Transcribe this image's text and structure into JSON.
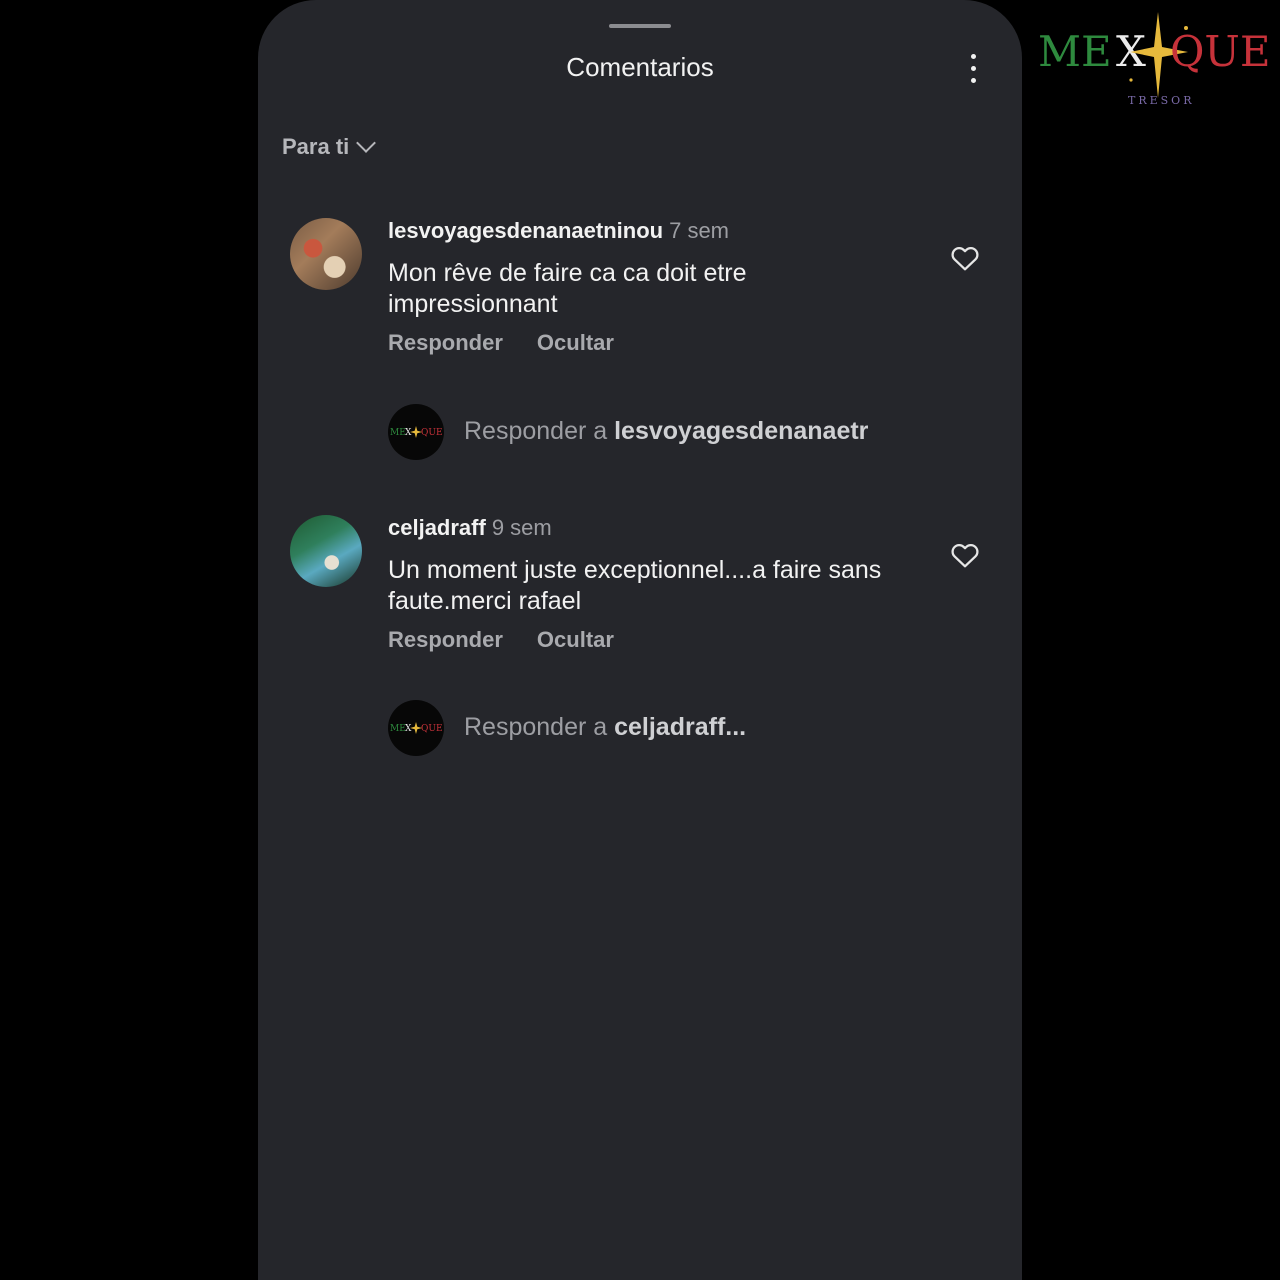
{
  "sheet": {
    "title": "Comentarios",
    "sort_label": "Para ti"
  },
  "comments": [
    {
      "username": "lesvoyagesdenanaetninou",
      "time": "7 sem",
      "text": "Mon rêve de faire ca ca doit etre impressionnant",
      "reply_label": "Responder",
      "hide_label": "Ocultar",
      "reply_prompt": "Responder a",
      "reply_target": "lesvoyagesdenanaetr"
    },
    {
      "username": "celjadraff",
      "time": "9 sem",
      "text": "Un moment juste exceptionnel....a faire sans faute.merci rafael",
      "reply_label": "Responder",
      "hide_label": "Ocultar",
      "reply_prompt": "Responder a",
      "reply_target": "celjadraff..."
    }
  ],
  "logo": {
    "left": "ME",
    "x": "X",
    "right": "QUE",
    "sub": "TRESOR"
  },
  "colors": {
    "sheet_bg": "#25262b",
    "page_bg": "#000000",
    "text_primary": "#f2f2f2",
    "text_secondary": "#9d9ea3",
    "logo_green": "#2e8a3e",
    "logo_red": "#c6323a",
    "logo_gold": "#e6b93c"
  },
  "icons": [
    "more-vertical-icon",
    "chevron-down-icon",
    "heart-outline-icon"
  ]
}
